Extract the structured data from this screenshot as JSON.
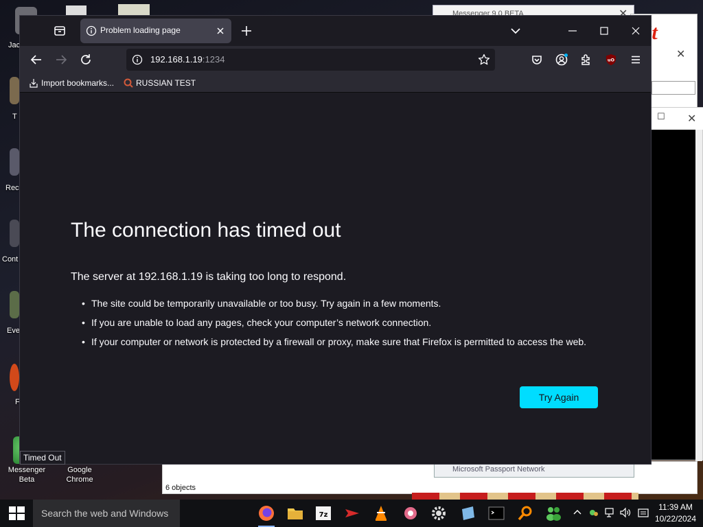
{
  "desktop": {
    "icons_partial": [
      "Jac",
      "T",
      "Rec",
      "Cont",
      "Eve",
      "F"
    ],
    "messenger_icon_label": "Messenger Beta",
    "chrome_icon_label": "Google Chrome",
    "background_window_title": "Messenger 9.0 BETA",
    "background_red_text": "it",
    "explorer_status": "6 objects",
    "passport_label": "Microsoft Passport Network"
  },
  "browser": {
    "tab": {
      "title": "Problem loading page"
    },
    "url": {
      "host": "192.168.1.19",
      "port": ":1234"
    },
    "bookmarks": [
      {
        "label": "Import bookmarks...",
        "icon": "import-icon"
      },
      {
        "label": "RUSSIAN TEST",
        "icon": "magnifier-icon"
      }
    ],
    "toolbar_icons": [
      "pocket-icon",
      "account-icon",
      "extensions-icon",
      "ublock-icon",
      "menu-icon"
    ],
    "status_tooltip": "Timed Out"
  },
  "error_page": {
    "title": "The connection has timed out",
    "description": "The server at 192.168.1.19 is taking too long to respond.",
    "bullets": [
      "The site could be temporarily unavailable or too busy. Try again in a few moments.",
      "If you are unable to load any pages, check your computer’s network connection.",
      "If your computer or network is protected by a firewall or proxy, make sure that Firefox is permitted to access the web."
    ],
    "button_label": "Try Again",
    "button_color": "#00ddff"
  },
  "taskbar": {
    "search_placeholder": "Search the web and Windows",
    "apps": [
      "firefox-icon",
      "folder-icon",
      "7zip-icon",
      "red-app-icon",
      "vlc-icon",
      "gear-app-icon",
      "settings-icon",
      "notepad-icon",
      "terminal-icon",
      "search-app-icon",
      "messenger-icon"
    ],
    "clock": {
      "time": "11:39 AM",
      "date": "10/22/2024"
    }
  }
}
